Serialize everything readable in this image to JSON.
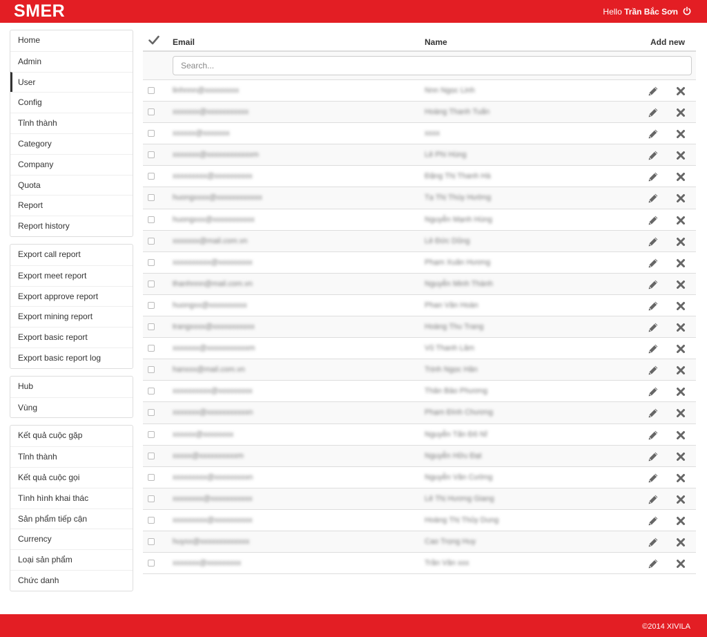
{
  "app": {
    "brand": "SMER",
    "greeting_prefix": "Hello",
    "user_name": "Trần Bắc Sơn"
  },
  "colors": {
    "brand_red": "#e31e24",
    "icon_gray": "#666666"
  },
  "icons": {
    "power": "power-icon",
    "check": "checkmark-icon",
    "edit": "pencil-icon",
    "delete": "close-icon"
  },
  "sidebar": {
    "group1": [
      {
        "label": "Home"
      },
      {
        "label": "Admin"
      },
      {
        "label": "User",
        "active": true
      },
      {
        "label": "Config"
      },
      {
        "label": "Tỉnh thành"
      },
      {
        "label": "Category"
      },
      {
        "label": "Company"
      },
      {
        "label": "Quota"
      },
      {
        "label": "Report"
      },
      {
        "label": "Report history"
      }
    ],
    "group2": [
      {
        "label": "Export call report"
      },
      {
        "label": "Export meet report"
      },
      {
        "label": "Export approve report"
      },
      {
        "label": "Export mining report"
      },
      {
        "label": "Export basic report"
      },
      {
        "label": "Export basic report log"
      }
    ],
    "group3": [
      {
        "label": "Hub"
      },
      {
        "label": "Vùng"
      }
    ],
    "group4": [
      {
        "label": "Kết quả cuộc gặp"
      },
      {
        "label": "Tỉnh thành"
      },
      {
        "label": "Kết quả cuộc gọi"
      },
      {
        "label": "Tình hình khai thác"
      },
      {
        "label": "Sản phẩm tiếp cận"
      },
      {
        "label": "Currency"
      },
      {
        "label": "Loại sản phẩm"
      },
      {
        "label": "Chức danh"
      }
    ]
  },
  "table": {
    "col_email": "Email",
    "col_name": "Name",
    "add_new": "Add new",
    "search_placeholder": "Search...",
    "rows": [
      {
        "email": "linhnnn@xxxxxxxxx",
        "name": "Nnn Ngọc Linh"
      },
      {
        "email": "xxxxxxx@xxxxxxxxxxx",
        "name": "Hoàng Thanh Tuấn"
      },
      {
        "email": "xxxxxx@xxxxxxx",
        "name": "xxxx"
      },
      {
        "email": "xxxxxxx@xxxxxxxxxxxxm",
        "name": "Lê Phi Hùng"
      },
      {
        "email": "xxxxxxxxx@xxxxxxxxxx",
        "name": "Đặng Thị Thanh Hà"
      },
      {
        "email": "huongxxxx@xxxxxxxxxxxx",
        "name": "Tạ Thị Thúy Hường"
      },
      {
        "email": "huongxxx@xxxxxxxxxxx",
        "name": "Nguyễn Mạnh Hùng"
      },
      {
        "email": "xxxxxxx@mail.com.vn",
        "name": "Lê Đức Dũng"
      },
      {
        "email": "xxxxxxxxxx@xxxxxxxxx",
        "name": "Phạm Xuân Hương"
      },
      {
        "email": "thanhnnn@mail.com.vn",
        "name": "Nguyễn Minh Thành"
      },
      {
        "email": "huongxx@xxxxxxxxxx",
        "name": "Phan Văn Hoàn"
      },
      {
        "email": "trangxxxx@xxxxxxxxxxx",
        "name": "Hoàng Thu Trang"
      },
      {
        "email": "xxxxxxx@xxxxxxxxxxxm",
        "name": "Vũ Thanh Lâm"
      },
      {
        "email": "hanxxx@mail.com.vn",
        "name": "Trịnh Ngọc Hân"
      },
      {
        "email": "xxxxxxxxxx@xxxxxxxxx",
        "name": "Thân Bảo Phương"
      },
      {
        "email": "xxxxxxx@xxxxxxxxxxxn",
        "name": "Phạm Đình Chương"
      },
      {
        "email": "xxxxxx@xxxxxxxx",
        "name": "Nguyễn Tấn Đô Nĩ"
      },
      {
        "email": "xxxxx@xxxxxxxxxxm",
        "name": "Nguyễn Hữu Đạt"
      },
      {
        "email": "xxxxxxxxx@xxxxxxxxxn",
        "name": "Nguyễn Văn Cường"
      },
      {
        "email": "xxxxxxxx@xxxxxxxxxxx",
        "name": "Lê Thị Hương Giang"
      },
      {
        "email": "xxxxxxxxx@xxxxxxxxxx",
        "name": "Hoàng Thị Thủy Dung"
      },
      {
        "email": "huyxx@xxxxxxxxxxxxx",
        "name": "Cao Trọng Huy"
      },
      {
        "email": "xxxxxxx@xxxxxxxxx",
        "name": "Trần Văn xxx"
      }
    ]
  },
  "footer": {
    "copyright": "©2014 XIVILA"
  }
}
